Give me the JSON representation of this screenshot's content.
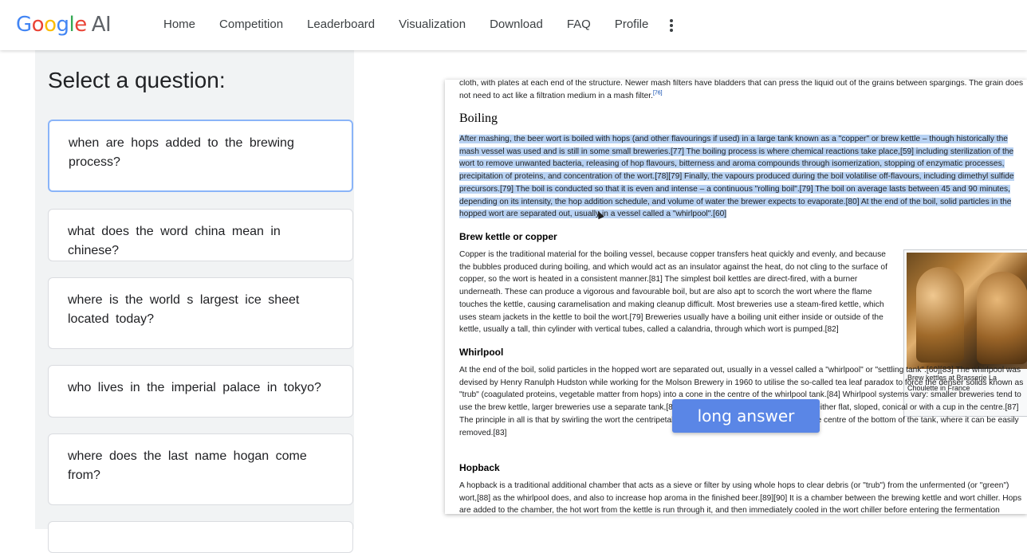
{
  "logo": {
    "letters": [
      "G",
      "o",
      "o",
      "g",
      "l",
      "e"
    ],
    "suffix": "AI"
  },
  "nav": [
    "Home",
    "Competition",
    "Leaderboard",
    "Visualization",
    "Download",
    "FAQ",
    "Profile"
  ],
  "sidebar": {
    "title": "Select a question:",
    "questions": [
      "when are hops added to the brewing process?",
      "what does the word china mean in chinese?",
      "where is the world s largest ice sheet located today?",
      "who lives in the imperial palace in tokyo?",
      "where does the last name hogan come from?"
    ]
  },
  "document": {
    "top_text_a": "cloth, with plates at each end of the structure. Newer mash filters have bladders that can press the liquid out of the grains between spargings. The grain does not need to act like a filtration medium in a mash filter.",
    "top_sup": "[76]",
    "heading_boiling": "Boiling",
    "boiling_paragraph": "After mashing, the beer wort is boiled with hops (and other flavourings if used) in a large tank known as a \"copper\" or brew kettle – though historically the mash vessel was used and is still in some small breweries.[77] The boiling process is where chemical reactions take place,[59] including sterilization of the wort to remove unwanted bacteria, releasing of hop flavours, bitterness and aroma compounds through isomerization, stopping of enzymatic processes, precipitation of proteins, and concentration of the wort.[78][79] Finally, the vapours produced during the boil volatilise off-flavours, including dimethyl sulfide precursors.[79] The boil is conducted so that it is even and intense – a continuous \"rolling boil\".[79] The boil on average lasts between 45 and 90 minutes, depending on its intensity, the hop addition schedule, and volume of water the brewer expects to evaporate.[80] At the end of the boil, solid particles in the hopped wort are separated out, usually in a vessel called a \"whirlpool\".[60]",
    "heading_kettle": "Brew kettle or copper",
    "kettle_paragraph": "Copper is the traditional material for the boiling vessel, because copper transfers heat quickly and evenly, and because the bubbles produced during boiling, and which would act as an insulator against the heat, do not cling to the surface of copper, so the wort is heated in a consistent manner.[81] The simplest boil kettles are direct-fired, with a burner underneath. These can produce a vigorous and favourable boil, but are also apt to scorch the wort where the flame touches the kettle, causing caramelisation and making cleanup difficult. Most breweries use a steam-fired kettle, which uses steam jackets in the kettle to boil the wort.[79] Breweries usually have a boiling unit either inside or outside of the kettle, usually a tall, thin cylinder with vertical tubes, called a calandria, through which wort is pumped.[82]",
    "heading_whirlpool": "Whirlpool",
    "whirlpool_paragraph": "At the end of the boil, solid particles in the hopped wort are separated out, usually in a vessel called a \"whirlpool\" or \"settling tank\".[60][83] The whirlpool was devised by Henry Ranulph Hudston while working for the Molson Brewery in 1960 to utilise the so-called tea leaf paradox to force the denser solids known as \"trub\" (coagulated proteins, vegetable matter from hops) into a cone in the centre of the whirlpool tank.[84] Whirlpool systems vary: smaller breweries tend to use the brew kettle, larger breweries use a separate tank,[83] and design will differ, with tank floors either flat, sloped, conical or with a cup in the centre.[87] The principle in all is that by swirling the wort the centripetal force will push the trub into a cone at the centre of the bottom of the tank, where it can be easily removed.[83]",
    "heading_hopback": "Hopback",
    "hopback_paragraph": "A hopback is a traditional additional chamber that acts as a sieve or filter by using whole hops to clear debris (or \"trub\") from the unfermented (or \"green\") wort,[88] as the whirlpool does, and also to increase hop aroma in the finished beer.[89][90] It is a chamber between the brewing kettle and wort chiller. Hops are added to the chamber, the hot wort from the kettle is run through it, and then immediately cooled in the wort chiller before entering the fermentation chamber. Hopbacks",
    "image_caption": "Brew kettles at Brasserie La Choulette in France"
  },
  "overlay_label": "long answer"
}
